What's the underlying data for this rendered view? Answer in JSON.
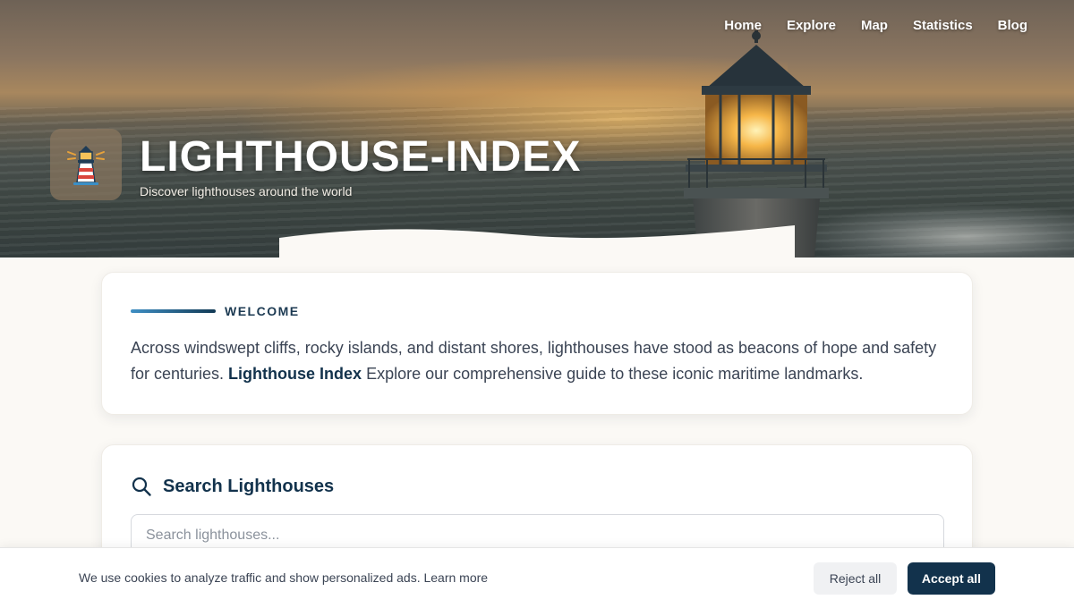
{
  "nav": {
    "items": [
      {
        "label": "Home"
      },
      {
        "label": "Explore"
      },
      {
        "label": "Map"
      },
      {
        "label": "Statistics"
      },
      {
        "label": "Blog"
      }
    ]
  },
  "brand": {
    "title": "LIGHTHOUSE-INDEX",
    "subtitle": "Discover lighthouses around the world",
    "logo_icon": "lighthouse-icon"
  },
  "welcome": {
    "label": "WELCOME",
    "text_before": "Across windswept cliffs, rocky islands, and distant shores, lighthouses have stood as beacons of hope and safety for centuries. ",
    "text_bold": "Lighthouse Index",
    "text_after": " Explore our comprehensive guide to these iconic maritime landmarks."
  },
  "search": {
    "icon": "search-icon",
    "title": "Search Lighthouses",
    "placeholder": "Search lighthouses...",
    "value": ""
  },
  "cookie": {
    "message": "We use cookies to analyze traffic and show personalized ads. ",
    "learn_more": "Learn more",
    "reject_label": "Reject all",
    "accept_label": "Accept all"
  },
  "colors": {
    "primary": "#12324c",
    "accent": "#3f8fc4",
    "background": "#fbf9f5"
  }
}
